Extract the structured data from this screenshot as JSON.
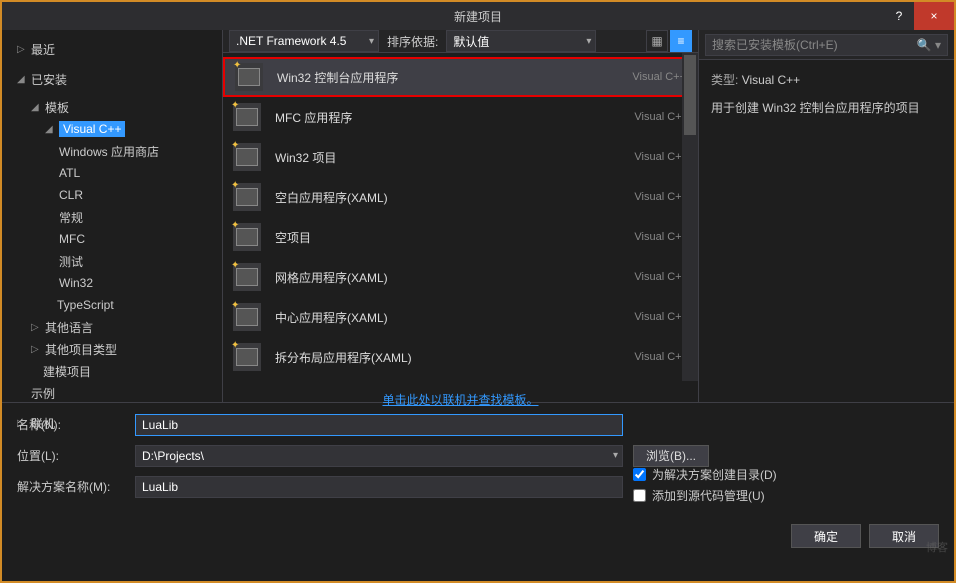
{
  "title": "新建项目",
  "titlebar": {
    "help": "?",
    "close": "×"
  },
  "tree": {
    "recent": "最近",
    "installed": "已安装",
    "templates": "模板",
    "vcpp": "Visual C++",
    "items_vcpp": [
      "Windows 应用商店",
      "ATL",
      "CLR",
      "常规",
      "MFC",
      "测试",
      "Win32"
    ],
    "typescript": "TypeScript",
    "other_lang": "其他语言",
    "other_proj": "其他项目类型",
    "model_proj": "建模项目",
    "samples": "示例",
    "online": "联机"
  },
  "header": {
    "framework": ".NET Framework 4.5",
    "sort_label": "排序依据:",
    "sort_value": "默认值"
  },
  "templates": [
    {
      "name": "Win32 控制台应用程序",
      "lang": "Visual C++",
      "selected": true,
      "highlighted": true
    },
    {
      "name": "MFC 应用程序",
      "lang": "Visual C++"
    },
    {
      "name": "Win32 项目",
      "lang": "Visual C++"
    },
    {
      "name": "空白应用程序(XAML)",
      "lang": "Visual C++"
    },
    {
      "name": "空项目",
      "lang": "Visual C++"
    },
    {
      "name": "网格应用程序(XAML)",
      "lang": "Visual C++"
    },
    {
      "name": "中心应用程序(XAML)",
      "lang": "Visual C++"
    },
    {
      "name": "拆分布局应用程序(XAML)",
      "lang": "Visual C++"
    }
  ],
  "online_link": "单击此处以联机并查找模板。",
  "right": {
    "search_placeholder": "搜索已安装模板(Ctrl+E)",
    "type_label": "类型:",
    "type_value": "Visual C++",
    "description": "用于创建 Win32 控制台应用程序的项目"
  },
  "form": {
    "name_label": "名称(N):",
    "name_value": "LuaLib",
    "location_label": "位置(L):",
    "location_value": "D:\\Projects\\",
    "solution_label": "解决方案名称(M):",
    "solution_value": "LuaLib",
    "browse": "浏览(B)...",
    "chk_create_dir": "为解决方案创建目录(D)",
    "chk_source_control": "添加到源代码管理(U)"
  },
  "buttons": {
    "ok": "确定",
    "cancel": "取消"
  },
  "watermark": "博客"
}
